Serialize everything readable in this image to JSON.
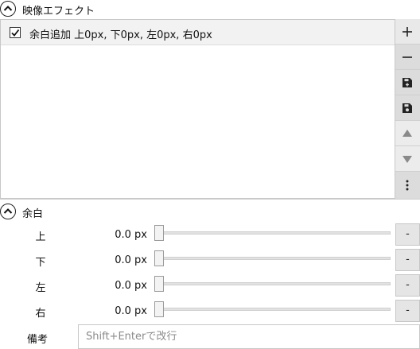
{
  "effects_section": {
    "title": "映像エフェクト",
    "items": [
      {
        "checked": true,
        "label": "余白追加 上0px, 下0px, 左0px, 右0px"
      }
    ],
    "toolbar": {
      "add": "plus-icon",
      "remove": "minus-icon",
      "save_new": "save-new-icon",
      "save": "save-icon",
      "move_up": "triangle-up-icon",
      "move_down": "triangle-down-icon",
      "more": "more-vertical-icon"
    }
  },
  "margin_section": {
    "title": "余白",
    "rows": [
      {
        "label": "上",
        "value": "0.0 px",
        "level": 0,
        "reset_label": "-"
      },
      {
        "label": "下",
        "value": "0.0 px",
        "level": 0,
        "reset_label": "-"
      },
      {
        "label": "左",
        "value": "0.0 px",
        "level": 0,
        "reset_label": "-"
      },
      {
        "label": "右",
        "value": "0.0 px",
        "level": 0,
        "reset_label": "-"
      }
    ]
  },
  "notes": {
    "label": "備考",
    "placeholder": "Shift+Enterで改行",
    "value": ""
  }
}
